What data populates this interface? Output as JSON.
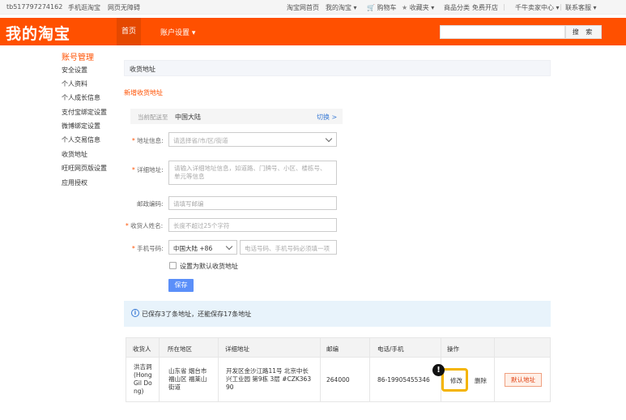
{
  "topbar": {
    "user": "tb517797274162",
    "mobile": "手机逛淘宝",
    "accessible": "网页无障碍",
    "home": "淘宝网首页",
    "my_taobao": "我的淘宝",
    "my_taobao_arrow": "▾",
    "cart": "购物车",
    "favorites": "收藏夹",
    "categories": "商品分类",
    "open_shop": "免费开店",
    "seller_center": "千牛卖家中心",
    "service": "联系客服",
    "dropdown_arrow": "▾",
    "separator": "|"
  },
  "header": {
    "logo": "我的淘宝",
    "nav_home": "首页",
    "nav_account": "账户设置 ▾",
    "search_button": "搜 索"
  },
  "sidebar": {
    "title": "账号管理",
    "items": [
      {
        "label": "安全设置"
      },
      {
        "label": "个人资料"
      },
      {
        "label": "个人成长信息"
      },
      {
        "label": "支付宝绑定设置"
      },
      {
        "label": "微博绑定设置"
      },
      {
        "label": "个人交易信息"
      },
      {
        "label": "收货地址"
      },
      {
        "label": "旺旺网页版设置"
      },
      {
        "label": "应用授权"
      }
    ]
  },
  "main": {
    "section_title": "收货地址",
    "new_address": "新增收货地址",
    "region": {
      "label": "当前配送至",
      "value": "中国大陆",
      "switch": "切换 >"
    },
    "form": {
      "required_mark": "*",
      "address_label": "地址信息:",
      "address_placeholder": "请选择省/市/区/街道",
      "detail_label": "详细地址:",
      "detail_placeholder": "请输入详细地址信息，如道路、门牌号、小区、楼栋号、单元等信息",
      "zip_label": "邮政编码:",
      "zip_placeholder": "请填写邮编",
      "name_label": "收货人姓名:",
      "name_placeholder": "长度不超过25个字符",
      "phone_label": "手机号码:",
      "phone_region": "中国大陆 +86",
      "phone_placeholder": "电话号码、手机号码必须填一项",
      "default_checkbox": "设置为默认收货地址",
      "save_button": "保存"
    },
    "info": {
      "icon": "i",
      "text": "已保存3了条地址，还能保存17条地址"
    },
    "table": {
      "headers": [
        "收货人",
        "所在地区",
        "详细地址",
        "邮编",
        "电话/手机",
        "操作"
      ],
      "row": {
        "name": [
          "洪吉洞",
          "(Hong",
          "Gil Do",
          "ng)"
        ],
        "region": [
          "山东省 烟台市",
          "福山区 福莱山",
          "街道"
        ],
        "address": [
          "开发区金沙江路11号 北京中长",
          "兴工业园 第9栋 3层 #CZK363",
          "90"
        ],
        "zip": "264000",
        "phone": "86-19905455346",
        "edit": "修改",
        "delete": "删除",
        "default_btn": "默认地址"
      }
    }
  },
  "annotation": {
    "marker": "!"
  }
}
